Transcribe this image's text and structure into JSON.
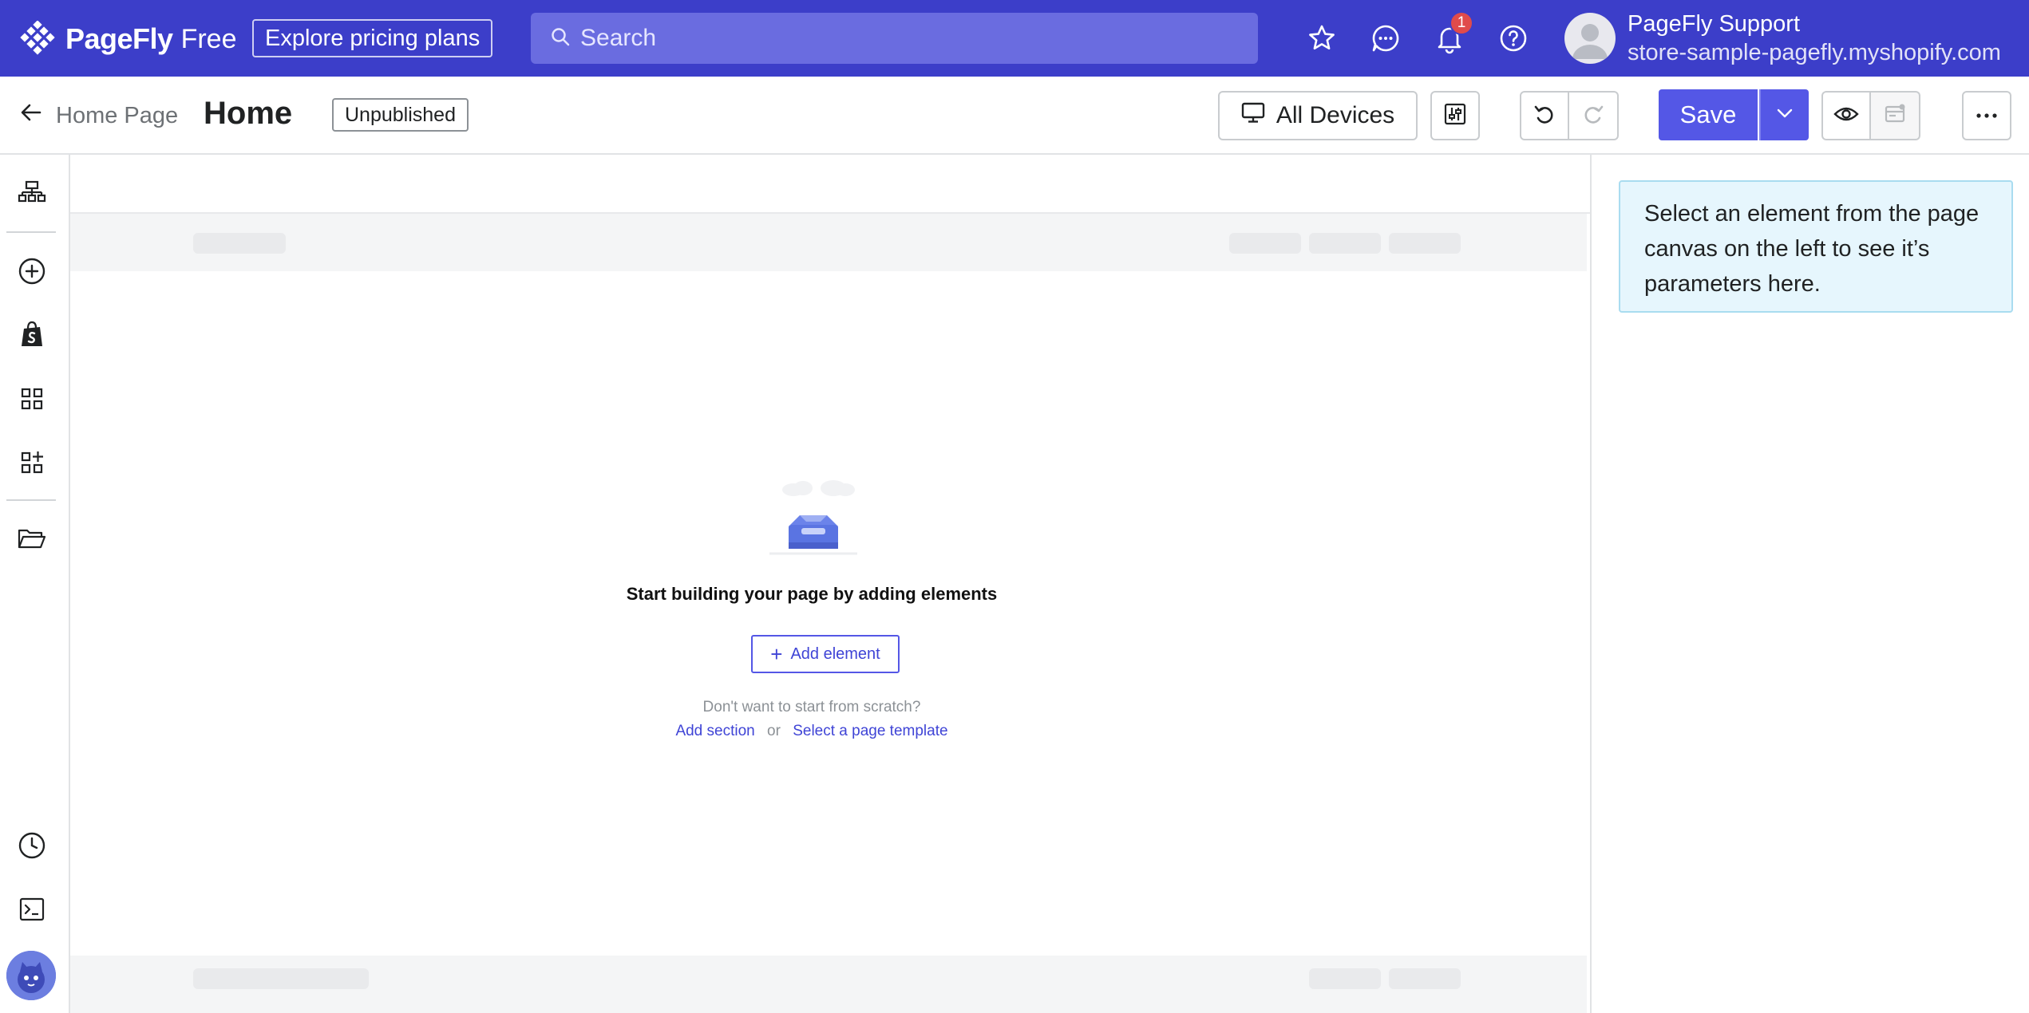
{
  "app": {
    "brand": "PageFly",
    "plan": "Free",
    "pricing_button": "Explore pricing plans",
    "search_placeholder": "Search",
    "notification_count": "1",
    "user_name": "PageFly Support",
    "user_store": "store-sample-pagefly.myshopify.com",
    "accent_color": "#3c3ec9"
  },
  "toolbar": {
    "back_label": "Home Page",
    "page_title": "Home",
    "status": "Unpublished",
    "devices_label": "All Devices",
    "save_label": "Save"
  },
  "canvas": {
    "empty_title": "Start building your page by adding elements",
    "add_element_label": "Add element",
    "scratch_prompt": "Don't want to start from scratch?",
    "add_section_label": "Add section",
    "or_label": "or",
    "template_label": "Select a page template"
  },
  "right_panel": {
    "hint": "Select an element from the page canvas on the left to see it’s parameters here."
  },
  "icons": {
    "top": [
      "star-icon",
      "chat-icon",
      "bell-icon",
      "help-icon"
    ],
    "rail": [
      "layers-icon",
      "add-icon",
      "shopify-icon",
      "grid-icon",
      "apps-add-icon",
      "folder-icon",
      "history-icon",
      "console-icon"
    ]
  }
}
